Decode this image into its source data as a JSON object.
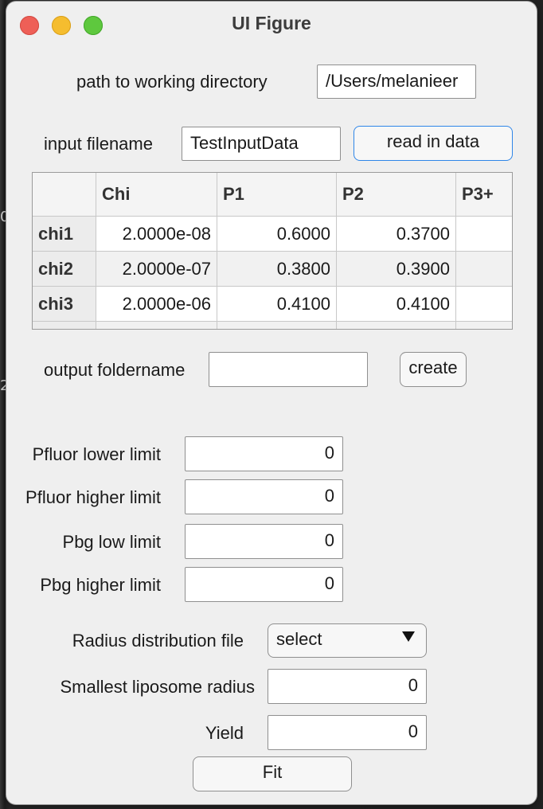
{
  "window": {
    "title": "UI Figure"
  },
  "background": {
    "marks": [
      "0",
      "2"
    ]
  },
  "working_dir": {
    "label": "path to working directory",
    "value": "/Users/melanieer"
  },
  "input_file": {
    "label": "input filename",
    "value": "TestInputData",
    "button": "read in data"
  },
  "table": {
    "columns": [
      "",
      "Chi",
      "P1",
      "P2",
      "P3+"
    ],
    "rows": [
      {
        "name": "chi1",
        "chi": "2.0000e-08",
        "p1": "0.6000",
        "p2": "0.3700",
        "p3": ""
      },
      {
        "name": "chi2",
        "chi": "2.0000e-07",
        "p1": "0.3800",
        "p2": "0.3900",
        "p3": ""
      },
      {
        "name": "chi3",
        "chi": "2.0000e-06",
        "p1": "0.4100",
        "p2": "0.4100",
        "p3": ""
      }
    ]
  },
  "output_folder": {
    "label": "output foldername",
    "value": "",
    "button": "create"
  },
  "limits": {
    "pfluor_lower": {
      "label": "Pfluor lower limit",
      "value": "0"
    },
    "pfluor_higher": {
      "label": "Pfluor higher limit",
      "value": "0"
    },
    "pbg_low": {
      "label": "Pbg low limit",
      "value": "0"
    },
    "pbg_higher": {
      "label": "Pbg higher limit",
      "value": "0"
    }
  },
  "radius_file": {
    "label": "Radius distribution file",
    "selected": "select"
  },
  "smallest_radius": {
    "label": "Smallest liposome radius",
    "value": "0"
  },
  "yield": {
    "label": "Yield",
    "value": "0"
  },
  "fit_button": "Fit"
}
